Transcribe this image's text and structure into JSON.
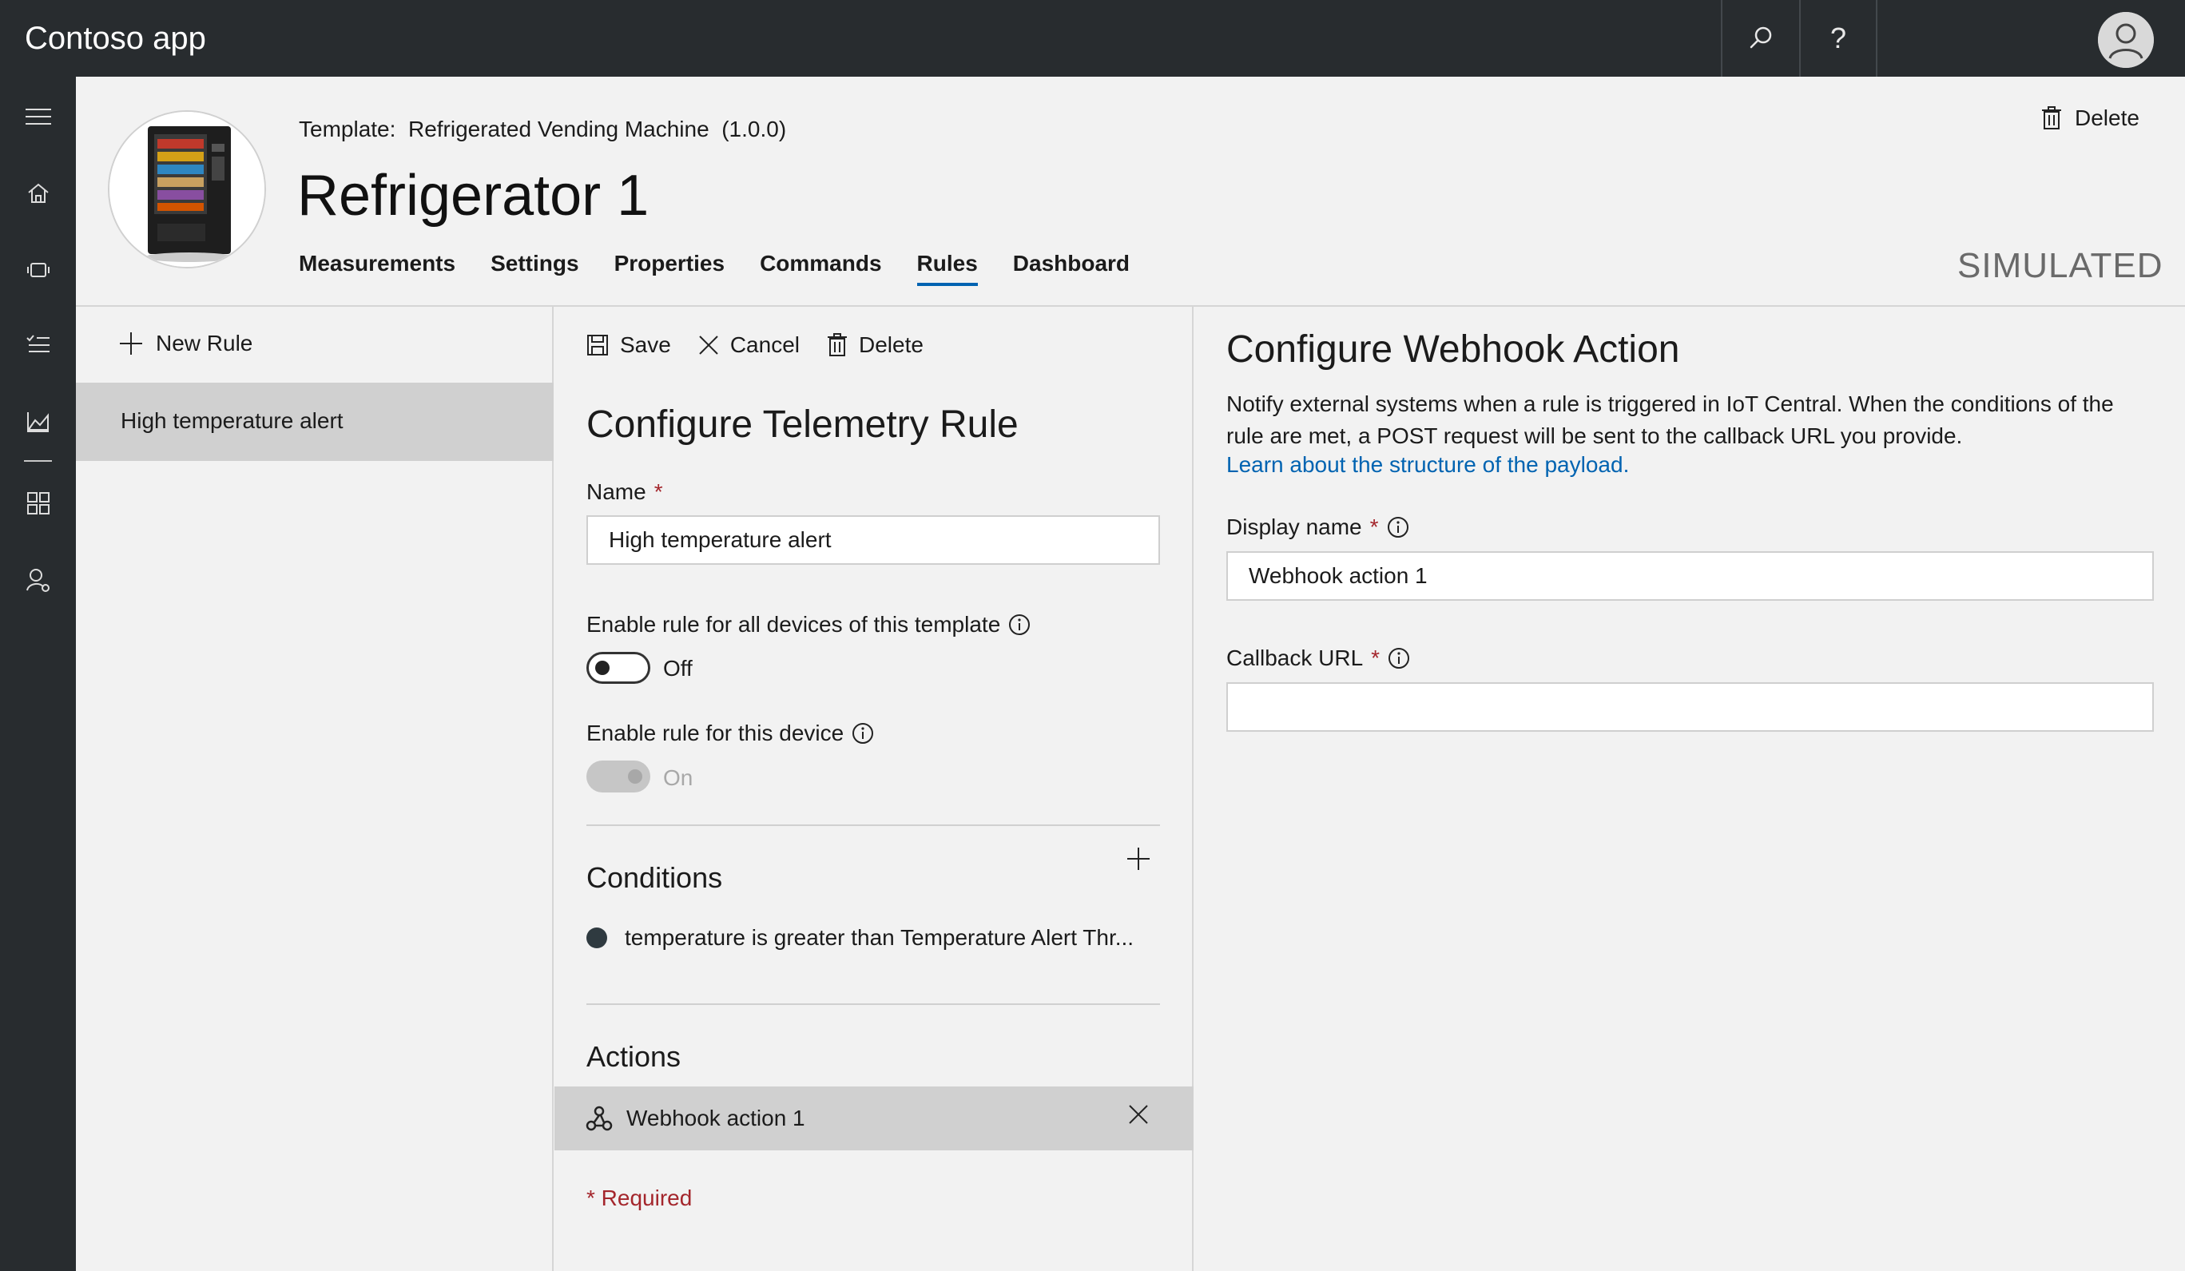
{
  "app": {
    "title": "Contoso app"
  },
  "topbar": {
    "search_icon": "search-icon",
    "help_label": "?",
    "avatar_icon": "user-avatar-icon"
  },
  "nav": {
    "items": [
      {
        "name": "menu",
        "icon": "hamburger-icon"
      },
      {
        "name": "home",
        "icon": "home-icon"
      },
      {
        "name": "devices",
        "icon": "device-icon"
      },
      {
        "name": "rules",
        "icon": "checklist-icon"
      },
      {
        "name": "analytics",
        "icon": "chart-icon"
      },
      {
        "name": "dashboards",
        "icon": "grid-icon"
      },
      {
        "name": "admin",
        "icon": "user-settings-icon"
      }
    ]
  },
  "header": {
    "template_label": "Template:",
    "template_name": "Refrigerated Vending Machine",
    "template_version": "(1.0.0)",
    "device_title": "Refrigerator 1",
    "tabs": [
      {
        "label": "Measurements"
      },
      {
        "label": "Settings"
      },
      {
        "label": "Properties"
      },
      {
        "label": "Commands"
      },
      {
        "label": "Rules",
        "active": true
      },
      {
        "label": "Dashboard"
      }
    ],
    "delete_label": "Delete",
    "status": "SIMULATED"
  },
  "rules_list": {
    "new_rule_label": "New Rule",
    "items": [
      {
        "label": "High temperature alert",
        "selected": true
      }
    ]
  },
  "telemetry_rule": {
    "toolbar": {
      "save_label": "Save",
      "cancel_label": "Cancel",
      "delete_label": "Delete"
    },
    "heading": "Configure Telemetry Rule",
    "name_label": "Name",
    "required_mark": "*",
    "name_value": "High temperature alert",
    "enable_template_label": "Enable rule for all devices of this template",
    "enable_template_state": "Off",
    "enable_device_label": "Enable rule for this device",
    "enable_device_state": "On",
    "conditions_title": "Conditions",
    "conditions": [
      {
        "text": "temperature is greater than Temperature Alert Thr..."
      }
    ],
    "actions_title": "Actions",
    "actions": [
      {
        "label": "Webhook action 1",
        "icon": "webhook-icon"
      }
    ],
    "required_note": "* Required"
  },
  "webhook": {
    "heading": "Configure Webhook Action",
    "description": "Notify external systems when a rule is triggered in IoT Central. When the conditions of the rule are met, a POST request will be sent to the callback URL you provide.",
    "link_text": "Learn about the structure of the payload.",
    "display_name_label": "Display name",
    "display_name_value": "Webhook action 1",
    "callback_url_label": "Callback URL",
    "callback_url_value": "",
    "required_mark": "*"
  },
  "colors": {
    "topbar": "#282c2f",
    "accent": "#0063b1",
    "required": "#a4262c",
    "selected": "#d0d0d0"
  }
}
